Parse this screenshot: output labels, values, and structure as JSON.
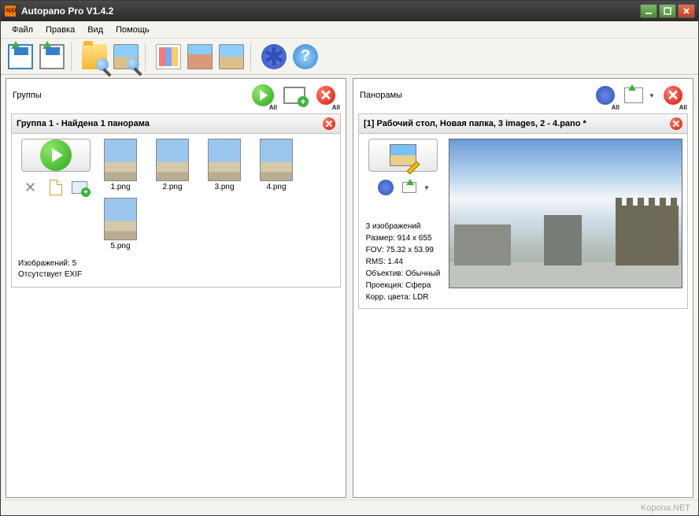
{
  "window": {
    "title": "Autopano Pro V1.4.2"
  },
  "menu": {
    "file": "Файл",
    "edit": "Правка",
    "view": "Вид",
    "help": "Помощь"
  },
  "groups_panel": {
    "label": "Группы",
    "all_badge": "All",
    "group": {
      "title": "Группа 1 - Найдена 1 панорама",
      "thumbs": [
        "1.png",
        "2.png",
        "3.png",
        "4.png",
        "5.png"
      ],
      "footer_count": "Изображений: 5",
      "footer_exif": "Отсутствует EXIF"
    }
  },
  "panos_panel": {
    "label": "Панорамы",
    "all_badge": "All",
    "pano": {
      "title": "[1] Рабочий стол, Новая папка, 3 images, 2 - 4.pano *",
      "info_count": "3 изображений",
      "info_size": "Размер: 914 x 655",
      "info_fov": "FOV: 75.32 x 53.99",
      "info_rms": "RMS: 1.44",
      "info_lens": "Объектив: Обычный",
      "info_proj": "Проекция: Сфера",
      "info_corr": "Корр. цвета: LDR"
    }
  },
  "statusbar": {
    "watermark": "Kopona.NET"
  }
}
